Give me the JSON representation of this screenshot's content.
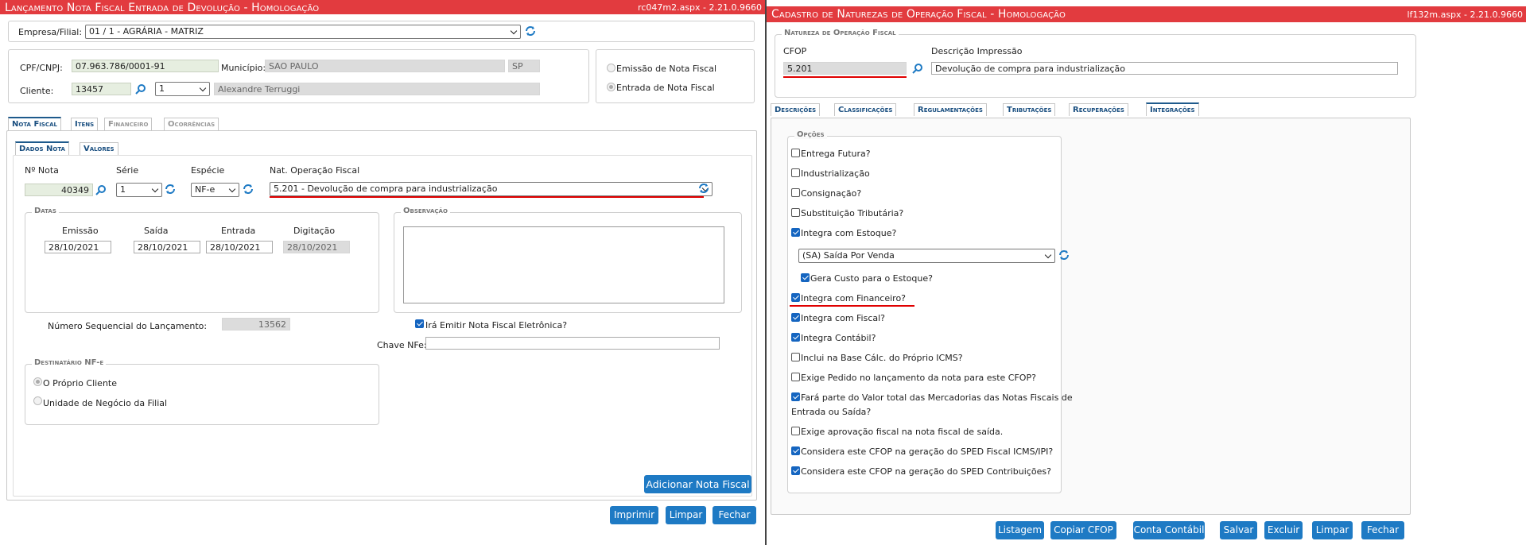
{
  "left": {
    "title": "Lançamento Nota Fiscal Entrada de Devolução  - Homologação",
    "version": "rc047m2.aspx - 2.21.0.9660",
    "empresa_label": "Empresa/Filial:",
    "empresa_value": "01 / 1 - AGRÁRIA - MATRIZ",
    "cpf_label": "CPF/CNPJ:",
    "cpf_value": "07.963.786/0001-91",
    "municipio_label": "Município:",
    "municipio_value": "SAO PAULO",
    "uf_value": "SP",
    "cliente_label": "Cliente:",
    "cliente_code": "13457",
    "cliente_seq": "1",
    "cliente_name": "Alexandre Terruggi",
    "radio_emissao": "Emissão de Nota Fiscal",
    "radio_entrada": "Entrada de Nota Fiscal",
    "tabs": [
      "Nota Fiscal",
      "Itens",
      "Financeiro",
      "Ocorrências"
    ],
    "subtabs": [
      "Dados Nota",
      "Valores"
    ],
    "nota_label": "Nº Nota",
    "nota_value": "40349",
    "serie_label": "Série",
    "serie_value": "1",
    "especie_label": "Espécie",
    "especie_value": "NF-e",
    "natop_label": "Nat. Operação Fiscal",
    "natop_value": "5.201 - Devolução de compra para industrialização",
    "datas_legend": "Datas",
    "emissao_label": "Emissão",
    "emissao_value": "28/10/2021",
    "saida_label": "Saída",
    "saida_value": "28/10/2021",
    "entrada_label": "Entrada",
    "entrada_value": "28/10/2021",
    "digitacao_label": "Digitação",
    "digitacao_value": "28/10/2021",
    "obs_legend": "Observação",
    "numseq_label": "Número Sequencial do Lançamento:",
    "numseq_value": "13562",
    "emitir_label": "Irá Emitir Nota Fiscal Eletrônica?",
    "chave_label": "Chave NFe:",
    "chave_value": "",
    "dest_legend": "Destinatário NF-e",
    "dest_opt1": "O Próprio Cliente",
    "dest_opt2": "Unidade de Negócio da Filial",
    "add_button": "Adicionar Nota Fiscal",
    "buttons": [
      "Imprimir",
      "Limpar",
      "Fechar"
    ]
  },
  "right": {
    "title": "Cadastro de Naturezas de Operação Fiscal  - Homologação",
    "version": "lf132m.aspx - 2.21.0.9660",
    "legend": "Natureza de Operação Fiscal",
    "cfop_label": "CFOP",
    "cfop_value": "5.201",
    "desc_label": "Descrição Impressão",
    "desc_value": "Devolução de compra para industrialização",
    "tabs": [
      "Descrições",
      "Classificações",
      "Regulamentações",
      "Tributações",
      "Recuperações",
      "Integrações"
    ],
    "opcoes_legend": "Opções",
    "options": [
      {
        "label": "Entrega Futura?",
        "checked": false
      },
      {
        "label": "Industrialização",
        "checked": false
      },
      {
        "label": "Consignação?",
        "checked": false
      },
      {
        "label": "Substituição Tributária?",
        "checked": false
      },
      {
        "label": "Integra com Estoque?",
        "checked": true
      }
    ],
    "estoque_select": "(SA) Saída Por Venda",
    "gera_custo": {
      "label": "Gera Custo para o Estoque?",
      "checked": true
    },
    "options2": [
      {
        "label": "Integra com Financeiro?",
        "checked": true
      },
      {
        "label": "Integra com Fiscal?",
        "checked": true
      },
      {
        "label": "Integra Contábil?",
        "checked": true
      },
      {
        "label": "Inclui na Base Cálc. do Próprio ICMS?",
        "checked": false
      },
      {
        "label": "Exige Pedido no lançamento da nota para este CFOP?",
        "checked": false
      }
    ],
    "fara_parte_line1": "Fará parte do Valor total das Mercadorias das Notas Fiscais de",
    "fara_parte_line2": "Entrada ou Saída?",
    "options3": [
      {
        "label": "Exige aprovação fiscal na nota fiscal de saída.",
        "checked": false
      },
      {
        "label": "Considera este CFOP na geração do SPED Fiscal ICMS/IPI?",
        "checked": true
      },
      {
        "label": "Considera este CFOP na geração do SPED Contribuições?",
        "checked": true
      }
    ],
    "buttons": [
      "Listagem",
      "Copiar CFOP",
      "Conta Contábil",
      "Salvar",
      "Excluir",
      "Limpar",
      "Fechar"
    ]
  },
  "colors": {
    "title_bar": "#e23b3f",
    "button": "#1e7ac4",
    "highlight": "#e00000",
    "tab_active": "#1e5a8c"
  }
}
